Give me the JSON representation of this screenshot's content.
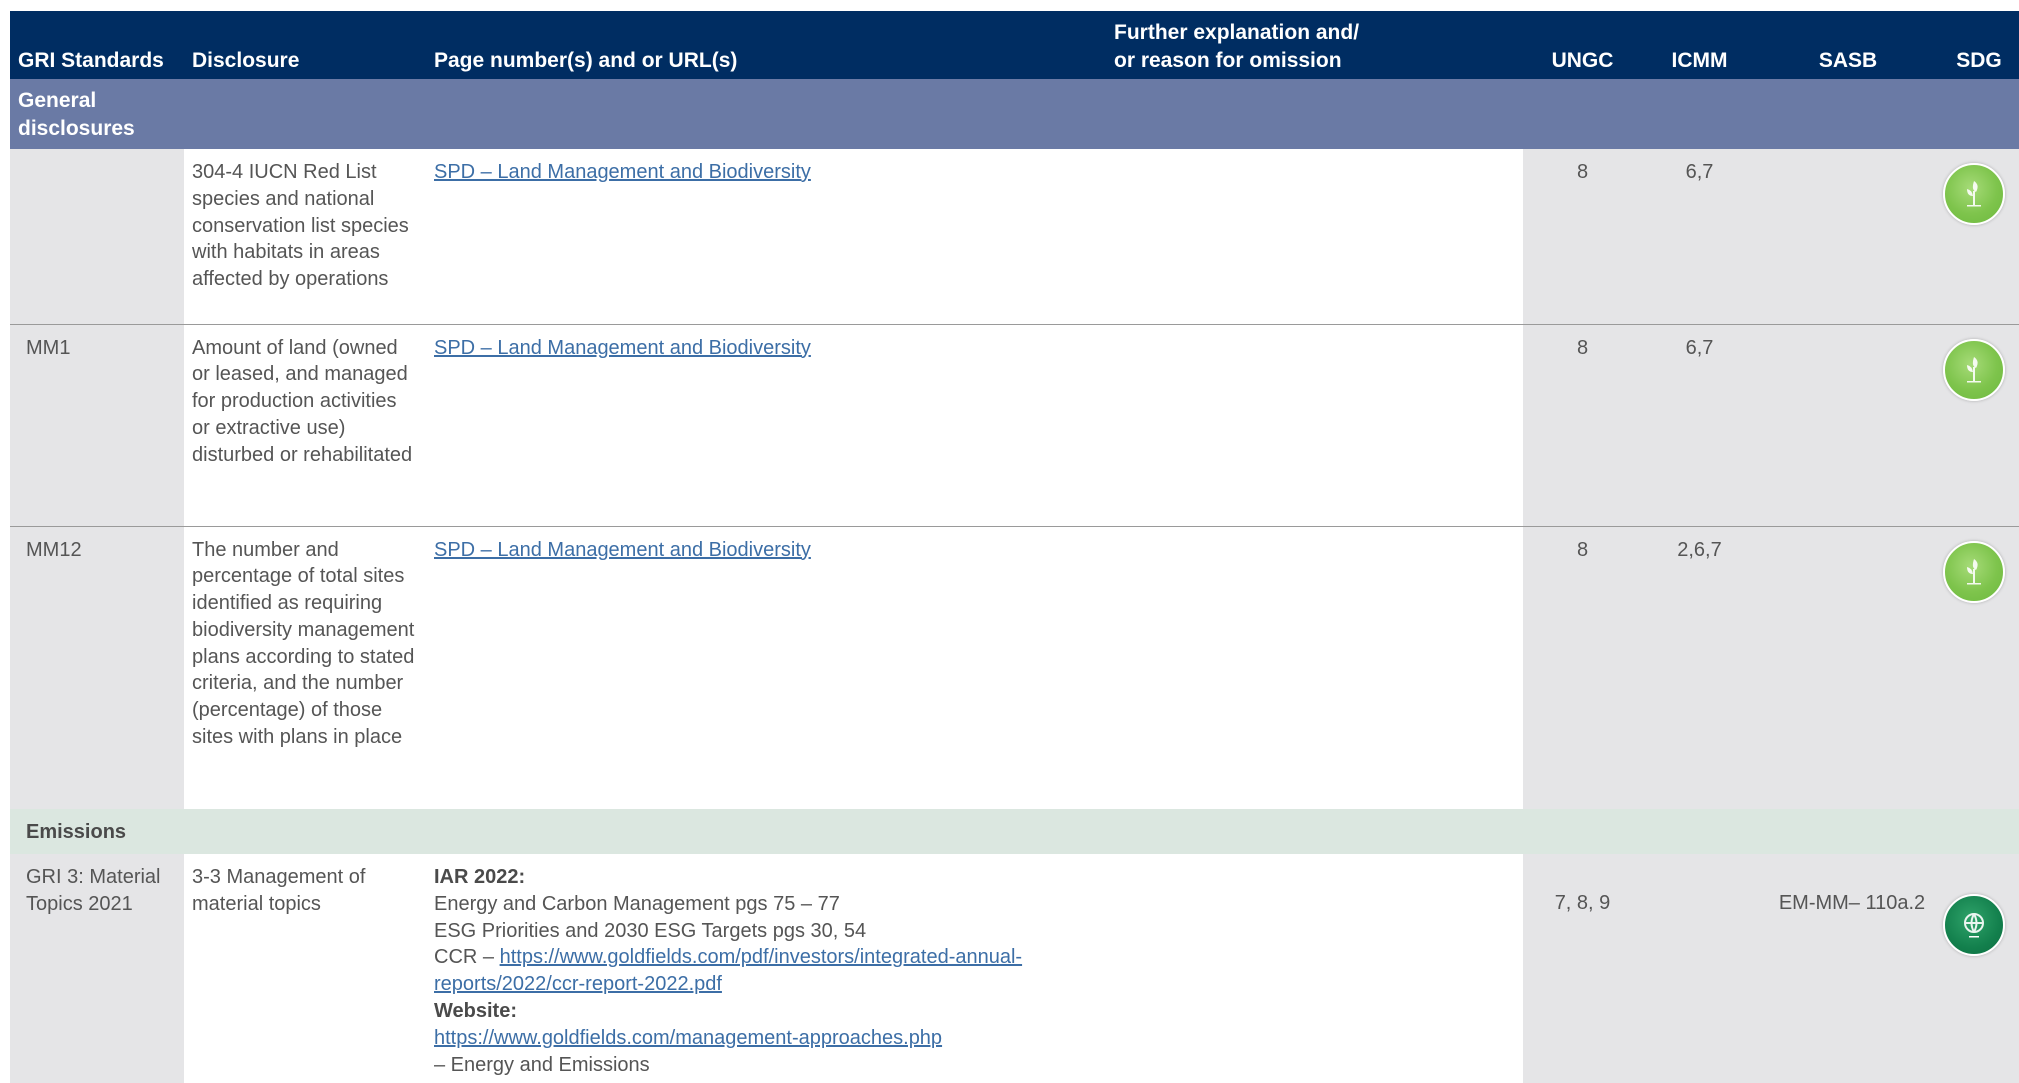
{
  "header": {
    "gri_standards": "GRI Standards",
    "disclosure": "Disclosure",
    "page_numbers": "Page number(s) and or URL(s)",
    "further_explanation_line1": "Further explanation and/",
    "further_explanation_line2": "or reason for omission",
    "ungc": "UNGC",
    "icmm": "ICMM",
    "sasb": "SASB",
    "sdg": "SDG"
  },
  "section_general": {
    "line1": "General",
    "line2": "disclosures"
  },
  "rows": [
    {
      "standard": "",
      "disclosure": "304-4 IUCN Red List species and national conservation list species with habitats in areas affected by operations",
      "link": "SPD – Land Management and Biodiversity",
      "ungc": "8",
      "icmm": "6,7",
      "sasb": "",
      "sdg_icon": "life-on-land-sdg-icon"
    },
    {
      "standard": "MM1",
      "disclosure": "Amount of land (owned or leased, and managed for production activities or extractive use) disturbed or rehabilitated",
      "link": "SPD – Land Management and Biodiversity",
      "ungc": "8",
      "icmm": "6,7",
      "sasb": "",
      "sdg_icon": "life-on-land-sdg-icon"
    },
    {
      "standard": "MM12",
      "disclosure": "The number and percentage of total sites identified as requiring biodiversity management plans according to stated criteria, and the number (percentage) of those sites with plans in place",
      "link": "SPD – Land Management and Biodiversity",
      "ungc": "8",
      "icmm": "2,6,7",
      "sasb": "",
      "sdg_icon": "life-on-land-sdg-icon"
    }
  ],
  "section_emissions": "Emissions",
  "emissions_row": {
    "standard": "GRI 3: Material Topics 2021",
    "disclosure": "3-3 Management of material topics",
    "iar_heading": "IAR 2022:",
    "line_energy": "Energy and Carbon Management pgs 75 – 77",
    "line_esg": "ESG Priorities and 2030 ESG Targets pgs 30, 54",
    "ccr_prefix": "CCR – ",
    "ccr_link": "https://www.goldfields.com/pdf/investors/integrated-annual-reports/2022/ccr-report-2022.pdf",
    "website_heading": "Website:",
    "website_link": "https://www.goldfields.com/management-approaches.php",
    "website_suffix": "– Energy and Emissions",
    "ungc": "7, 8, 9",
    "icmm": "",
    "sasb": "EM-MM– 110a.2",
    "sdg_icon": "climate-action-sdg-icon"
  },
  "colors": {
    "header_bg": "#002d62",
    "section_general_bg": "#6a7aa5",
    "section_emissions_bg": "#dbe7e0",
    "gray_cell": "#e5e5e7",
    "link": "#3c6ea6"
  }
}
